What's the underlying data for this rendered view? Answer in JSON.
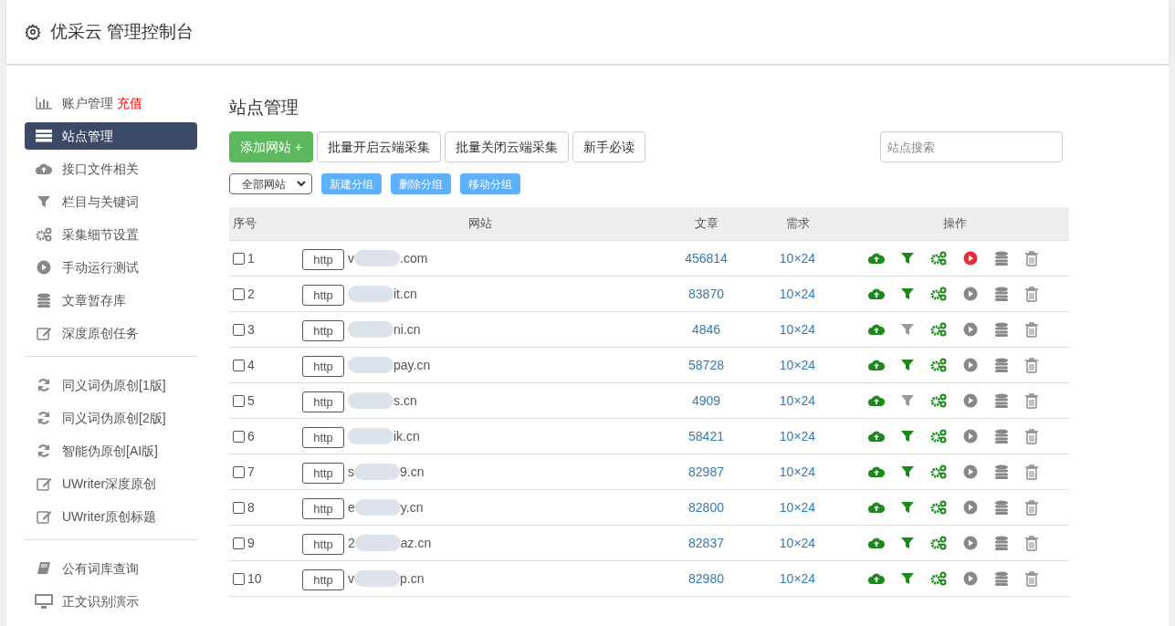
{
  "header": {
    "title": "优采云 管理控制台"
  },
  "sidebar": {
    "groups": [
      [
        {
          "label": "账户管理",
          "badge": "充值",
          "kind": "chart",
          "selected": false
        },
        {
          "label": "站点管理",
          "kind": "server",
          "selected": true
        },
        {
          "label": "接口文件相关",
          "kind": "cloud",
          "selected": false
        },
        {
          "label": "栏目与关键词",
          "kind": "filter",
          "selected": false
        },
        {
          "label": "采集细节设置",
          "kind": "gears",
          "selected": false
        },
        {
          "label": "手动运行测试",
          "kind": "play",
          "selected": false
        },
        {
          "label": "文章暂存库",
          "kind": "db",
          "selected": false
        },
        {
          "label": "深度原创任务",
          "kind": "edit",
          "selected": false
        }
      ],
      [
        {
          "label": "同义词伪原创[1版]",
          "kind": "refresh",
          "selected": false
        },
        {
          "label": "同义词伪原创[2版]",
          "kind": "refresh",
          "selected": false
        },
        {
          "label": "智能伪原创[AI版]",
          "kind": "refresh",
          "selected": false
        },
        {
          "label": "UWriter深度原创",
          "kind": "edit",
          "selected": false
        },
        {
          "label": "UWriter原创标题",
          "kind": "edit",
          "selected": false
        }
      ],
      [
        {
          "label": "公有词库查询",
          "kind": "book",
          "selected": false
        },
        {
          "label": "正文识别演示",
          "kind": "monitor",
          "selected": false
        }
      ]
    ]
  },
  "main": {
    "title": "站点管理",
    "buttons": [
      {
        "label": "添加网站 +",
        "kind": "primary"
      },
      {
        "label": "批量开启云端采集",
        "kind": "default"
      },
      {
        "label": "批量关闭云端采集",
        "kind": "default"
      },
      {
        "label": "新手必读",
        "kind": "default"
      }
    ],
    "search": {
      "placeholder": "站点搜索"
    },
    "group_select": "全部网站",
    "group_buttons": [
      "新建分组",
      "删除分组",
      "移动分组"
    ],
    "table": {
      "columns": [
        "序号",
        "网站",
        "文章",
        "需求",
        "操作"
      ],
      "rows": [
        {
          "index": "1",
          "checked": false,
          "scheme": "http",
          "domain_start": "v",
          "domain_end": ".com",
          "articles": "456814",
          "demand": "10×24",
          "filter_on": true,
          "running": true
        },
        {
          "index": "2",
          "checked": false,
          "scheme": "http",
          "domain_start": "",
          "domain_end": "it.cn",
          "articles": "83870",
          "demand": "10×24",
          "filter_on": true,
          "running": false
        },
        {
          "index": "3",
          "checked": false,
          "scheme": "http",
          "domain_start": "",
          "domain_end": "ni.cn",
          "articles": "4846",
          "demand": "10×24",
          "filter_on": false,
          "running": false
        },
        {
          "index": "4",
          "checked": false,
          "scheme": "http",
          "domain_start": "",
          "domain_end": "pay.cn",
          "articles": "58728",
          "demand": "10×24",
          "filter_on": true,
          "running": false
        },
        {
          "index": "5",
          "checked": false,
          "scheme": "http",
          "domain_start": "",
          "domain_end": "s.cn",
          "articles": "4909",
          "demand": "10×24",
          "filter_on": false,
          "running": false
        },
        {
          "index": "6",
          "checked": false,
          "scheme": "http",
          "domain_start": "",
          "domain_end": "ik.cn",
          "articles": "58421",
          "demand": "10×24",
          "filter_on": true,
          "running": false
        },
        {
          "index": "7",
          "checked": false,
          "scheme": "http",
          "domain_start": "s",
          "domain_end": "9.cn",
          "articles": "82987",
          "demand": "10×24",
          "filter_on": true,
          "running": false
        },
        {
          "index": "8",
          "checked": false,
          "scheme": "http",
          "domain_start": "e",
          "domain_end": "y.cn",
          "articles": "82800",
          "demand": "10×24",
          "filter_on": true,
          "running": false
        },
        {
          "index": "9",
          "checked": false,
          "scheme": "http",
          "domain_start": "2",
          "domain_end": "az.cn",
          "articles": "82837",
          "demand": "10×24",
          "filter_on": true,
          "running": false
        },
        {
          "index": "10",
          "checked": false,
          "scheme": "http",
          "domain_start": "v",
          "domain_end": "p.cn",
          "articles": "82980",
          "demand": "10×24",
          "filter_on": true,
          "running": false
        }
      ]
    }
  }
}
